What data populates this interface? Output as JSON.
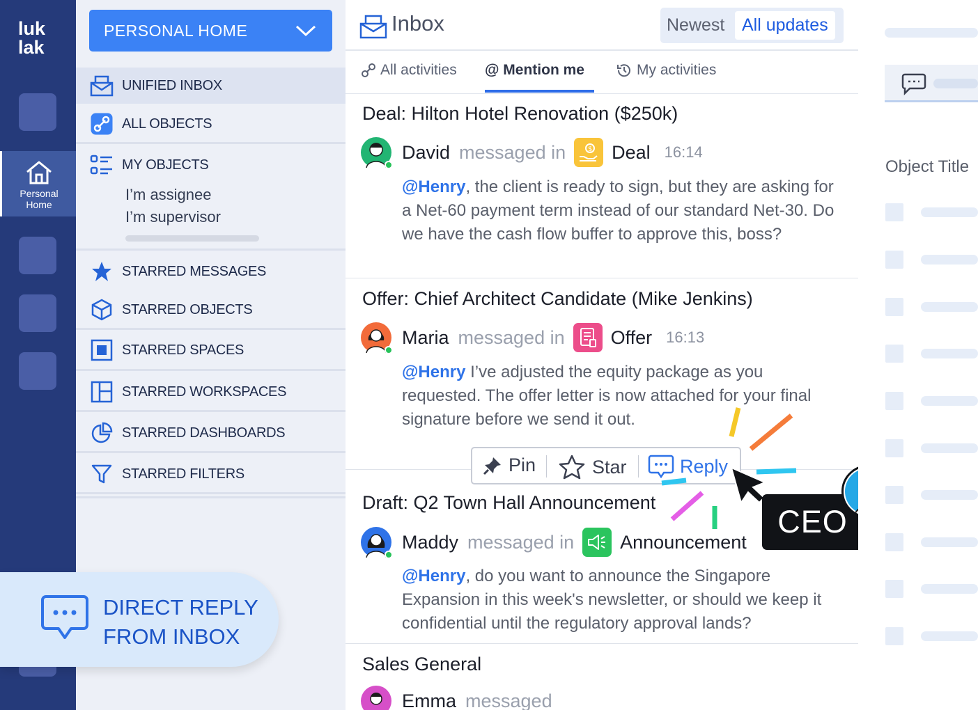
{
  "brand": {
    "logo_line1": "luk",
    "logo_line2": "lak"
  },
  "rail": {
    "home_label_1": "Personal",
    "home_label_2": "Home"
  },
  "nav": {
    "header_label": "PERSONAL HOME",
    "items": [
      {
        "label": "UNIFIED INBOX",
        "icon": "inbox-icon"
      },
      {
        "label": "ALL OBJECTS",
        "icon": "link-icon"
      },
      {
        "label": "MY OBJECTS",
        "icon": "list-icon"
      },
      {
        "label": "STARRED MESSAGES",
        "icon": "star-icon"
      },
      {
        "label": "STARRED OBJECTS",
        "icon": "cube-icon"
      },
      {
        "label": "STARRED SPACES",
        "icon": "square-icon"
      },
      {
        "label": "STARRED WORKSPACES",
        "icon": "layout-icon"
      },
      {
        "label": "STARRED DASHBOARDS",
        "icon": "pie-icon"
      },
      {
        "label": "STARRED FILTERS",
        "icon": "filter-icon"
      }
    ],
    "sub_items": [
      "I’m assignee",
      "I’m supervisor"
    ]
  },
  "callout": {
    "line1": "DIRECT REPLY",
    "line2": "FROM INBOX"
  },
  "inbox": {
    "title": "Inbox",
    "sort": {
      "option1": "Newest",
      "option2": "All updates"
    },
    "tabs": [
      "All activities",
      "@ Mention me",
      "My activities"
    ],
    "messages": [
      {
        "title": "Deal: Hilton Hotel Renovation ($250k)",
        "sender": "David",
        "verb": "messaged in",
        "object": "Deal",
        "time": "16:14",
        "mention": "@Henry",
        "body": ", the client is ready to sign, but they are asking for a Net-60 payment term instead of our standard Net-30. Do we have the cash flow buffer to approve this, boss?"
      },
      {
        "title": "Offer: Chief Architect Candidate (Mike Jenkins)",
        "sender": "Maria",
        "verb": "messaged in",
        "object": "Offer",
        "time": "16:13",
        "mention": "@Henry",
        "body": " I’ve adjusted the equity package as you requested. The offer letter is now attached for your final signature before we send it out."
      },
      {
        "title": "Draft: Q2 Town Hall Announcement",
        "sender": "Maddy",
        "verb": "messaged in",
        "object": "Announcement",
        "time": "",
        "mention": "@Henry",
        "body": ", do you want to announce the Singapore Expansion in this week's newsletter, or should we keep it confidential until the regulatory approval lands?"
      },
      {
        "title": "Sales General",
        "sender": "Emma",
        "verb": "messaged",
        "object": "",
        "time": "",
        "mention": "",
        "body": ""
      }
    ],
    "actions": {
      "pin": "Pin",
      "star": "Star",
      "reply": "Reply"
    }
  },
  "badge": {
    "label": "CEO"
  },
  "right_panel": {
    "object_title": "Object Title"
  },
  "colors": {
    "rail": "#253a7a",
    "accent": "#3b82f5",
    "mention": "#2f73e8",
    "deal": "#f9c43a",
    "offer": "#ec4d8a",
    "announcement": "#2bc45e"
  }
}
